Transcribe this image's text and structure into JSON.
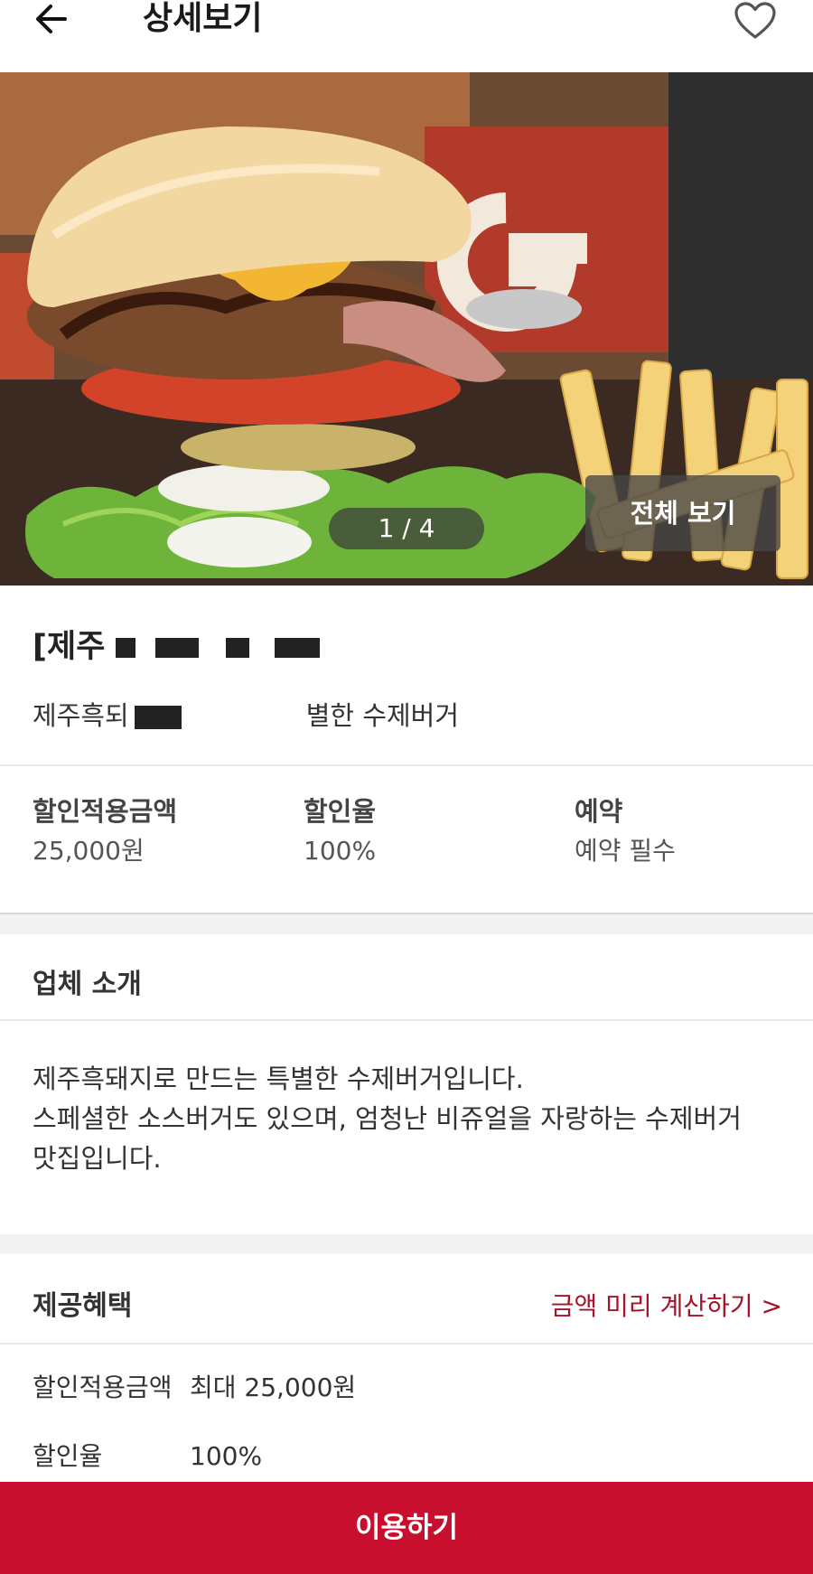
{
  "header": {
    "title": "상세보기",
    "back_icon": "arrow-left-icon",
    "favorite_icon": "heart-outline-icon"
  },
  "gallery": {
    "counter": "1 / 4",
    "view_all": "전체 보기"
  },
  "shop": {
    "title_visible": "[제주",
    "desc_start": "제주흑되",
    "desc_end": "별한 수제버거"
  },
  "info": [
    {
      "label": "할인적용금액",
      "value": "25,000원"
    },
    {
      "label": "할인율",
      "value": "100%"
    },
    {
      "label": "예약",
      "value": "예약 필수"
    }
  ],
  "intro": {
    "title": "업체 소개",
    "lines": [
      "제주흑돼지로 만드는 특별한 수제버거입니다.",
      "스페셜한 소스버거도 있으며, 엄청난 비쥬얼을 자랑하는 수제버거",
      "맛집입니다."
    ]
  },
  "benefits": {
    "title": "제공혜택",
    "calc_link": "금액 미리 계산하기 >",
    "rows": [
      {
        "label": "할인적용금액",
        "value": "최대 25,000원"
      },
      {
        "label": "할인율",
        "value": "100%"
      }
    ]
  },
  "cta": {
    "label": "이용하기"
  },
  "colors": {
    "accent": "#c8102e",
    "link": "#a3142a"
  }
}
